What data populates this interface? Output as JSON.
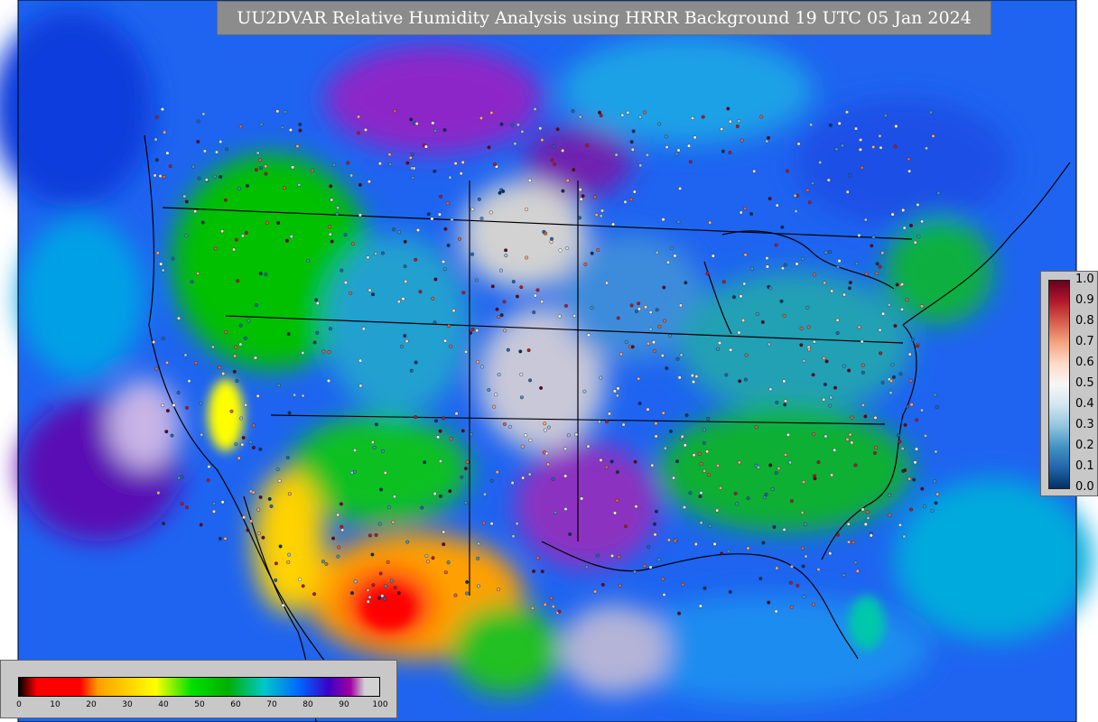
{
  "title": "UU2DVAR Relative Humidity Analysis using HRRR Background 19 UTC 05 Jan 2024",
  "obs_legend": {
    "ticks": [
      "1.0",
      "0.9",
      "0.8",
      "0.7",
      "0.6",
      "0.5",
      "0.4",
      "0.3",
      "0.2",
      "0.1",
      "0.0"
    ],
    "colors": [
      "#67001f",
      "#b2182b",
      "#d6604d",
      "#f4a582",
      "#fddbc7",
      "#f7f7f7",
      "#d1e5f0",
      "#92c5de",
      "#4393c3",
      "#2166ac",
      "#053061"
    ]
  },
  "rh_colorbar": {
    "ticks": [
      "0",
      "10",
      "20",
      "30",
      "40",
      "50",
      "60",
      "70",
      "80",
      "90",
      "100"
    ],
    "colors": [
      "#000000",
      "#ff0000",
      "#ff0000",
      "#ffa000",
      "#ffff00",
      "#00e000",
      "#00b000",
      "#00c8c8",
      "#0064ff",
      "#3c00c8",
      "#a000a0",
      "#d2d2d2"
    ]
  }
}
